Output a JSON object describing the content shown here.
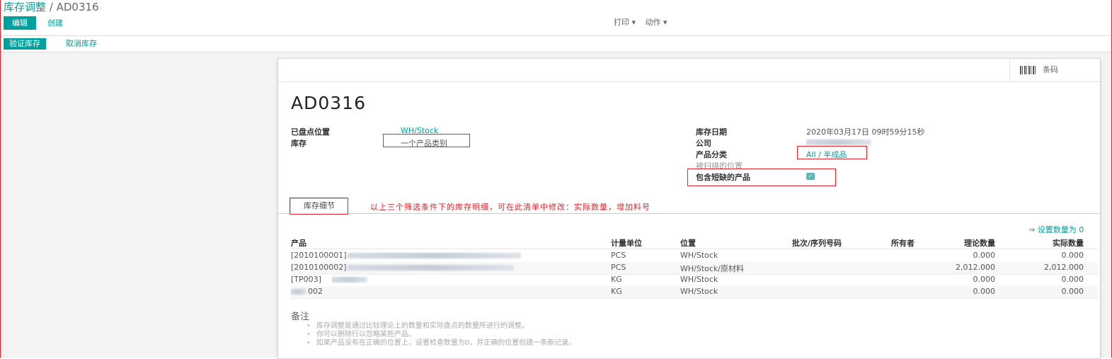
{
  "header": {
    "breadcrumb_parent": "库存调整",
    "breadcrumb_sep": " / ",
    "breadcrumb_current": "AD0316",
    "edit_label": "编辑",
    "create_label": "创建",
    "print_label": "打印 ▾",
    "action_label": "动作 ▾"
  },
  "status": {
    "validate_label": "验证库存",
    "cancel_label": "取消库存"
  },
  "sheet": {
    "barcode_label": "条码",
    "title": "AD0316"
  },
  "fields": {
    "location_label": "已盘点位置",
    "location_value": "WH/Stock",
    "inventory_label": "库存",
    "inventory_value": "一个产品类别",
    "date_label": "库存日期",
    "date_value": "2020年03月17日 09时59分15秒",
    "company_label": "公司",
    "category_label": "产品分类",
    "category_value": "All / 半成品",
    "scanned_location_label": "被扫描的位置",
    "exhausted_label": "包含短缺的产品",
    "exhausted_checked": true
  },
  "tab_label": "库存细节",
  "annotation": "以上三个筛选条件下的库存明细，可在此清单中修改：实际数量，增加料号",
  "set_qty_label": "⇒ 设置数量为 0",
  "table": {
    "headers": [
      "产品",
      "计量单位",
      "位置",
      "批次/序列号码",
      "所有者",
      "理论数量",
      "实际数量"
    ],
    "rows": [
      {
        "product": "[2010100001]",
        "uom": "PCS",
        "location": "WH/Stock",
        "theoretical": "0.000",
        "real": "0.000"
      },
      {
        "product": "[2010100002]",
        "uom": "PCS",
        "location": "WH/Stock/原材料",
        "theoretical": "2,012.000",
        "real": "2,012.000"
      },
      {
        "product": "[TP003]",
        "uom": "KG",
        "location": "WH/Stock",
        "theoretical": "0.000",
        "real": "0.000"
      },
      {
        "product": "002",
        "uom": "KG",
        "location": "WH/Stock",
        "theoretical": "0.000",
        "real": "0.000"
      }
    ]
  },
  "notes": {
    "title": "备注",
    "items": [
      "库存调整是通过比较理论上的数量和实际盘点的数量所进行的调整。",
      "你可以删除行以忽略某些产品。",
      "如果产品没有在正确的位置上，设置检查数量为0，并正确的位置创建一条新记录。"
    ]
  }
}
